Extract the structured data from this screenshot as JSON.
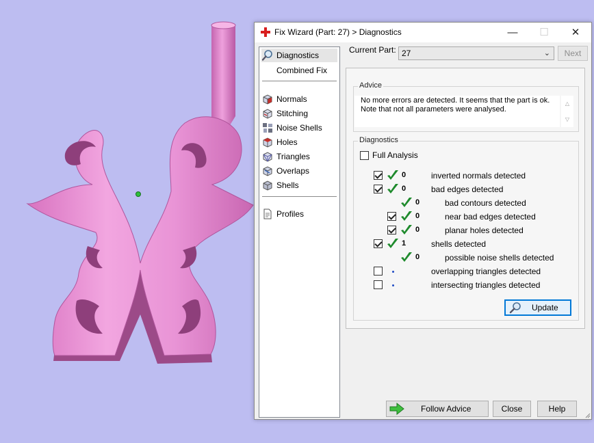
{
  "window": {
    "title": "Fix Wizard (Part: 27) > Diagnostics",
    "minimize_glyph": "—",
    "maximize_glyph": "☐",
    "close_glyph": "✕"
  },
  "nav": {
    "items": [
      {
        "label": "Diagnostics",
        "icon": "magnifier-icon",
        "selected": true
      },
      {
        "label": "Combined Fix",
        "icon": "none"
      },
      {
        "label": "Normals",
        "icon": "normals-cube-icon"
      },
      {
        "label": "Stitching",
        "icon": "stitching-cube-icon"
      },
      {
        "label": "Noise Shells",
        "icon": "noise-shells-cube-icon"
      },
      {
        "label": "Holes",
        "icon": "holes-cube-icon"
      },
      {
        "label": "Triangles",
        "icon": "triangles-cube-icon"
      },
      {
        "label": "Overlaps",
        "icon": "overlaps-cube-icon"
      },
      {
        "label": "Shells",
        "icon": "shells-cube-icon"
      },
      {
        "label": "Profiles",
        "icon": "profile-document-icon"
      }
    ]
  },
  "current_part": {
    "label": "Current Part:",
    "value": "27",
    "next_label": "Next"
  },
  "advice": {
    "title": "Advice",
    "text_line1": "No more errors are detected. It seems that the part is ok.",
    "text_line2": "Note that not all parameters were analysed."
  },
  "diagnostics": {
    "title": "Diagnostics",
    "full_analysis_label": "Full Analysis",
    "full_analysis_checked": false,
    "rows": [
      {
        "checked": true,
        "status": "ok",
        "count": "0",
        "text": "inverted normals detected",
        "level": 0,
        "has_checkbox": true
      },
      {
        "checked": true,
        "status": "ok",
        "count": "0",
        "text": "bad edges detected",
        "level": 0,
        "has_checkbox": true
      },
      {
        "checked": false,
        "status": "ok",
        "count": "0",
        "text": "bad contours detected",
        "level": 1,
        "has_checkbox": false
      },
      {
        "checked": true,
        "status": "ok",
        "count": "0",
        "text": "near bad edges detected",
        "level": 1,
        "has_checkbox": true
      },
      {
        "checked": true,
        "status": "ok",
        "count": "0",
        "text": "planar holes detected",
        "level": 1,
        "has_checkbox": true
      },
      {
        "checked": true,
        "status": "ok",
        "count": "1",
        "text": "shells detected",
        "level": 0,
        "has_checkbox": true
      },
      {
        "checked": false,
        "status": "ok",
        "count": "0",
        "text": "possible noise shells detected",
        "level": 1,
        "has_checkbox": false
      },
      {
        "checked": false,
        "status": "not-run",
        "count": "",
        "text": "overlapping triangles detected",
        "level": 0,
        "has_checkbox": true
      },
      {
        "checked": false,
        "status": "not-run",
        "count": "",
        "text": "intersecting triangles detected",
        "level": 0,
        "has_checkbox": true
      }
    ],
    "update_label": "Update"
  },
  "buttons": {
    "follow_advice": "Follow Advice",
    "close": "Close",
    "help": "Help"
  },
  "colors": {
    "viewport_bg": "#bdbdf1",
    "model": "#e48fd0",
    "check_green": "#1e8a2c",
    "accent": "#0078d7"
  }
}
